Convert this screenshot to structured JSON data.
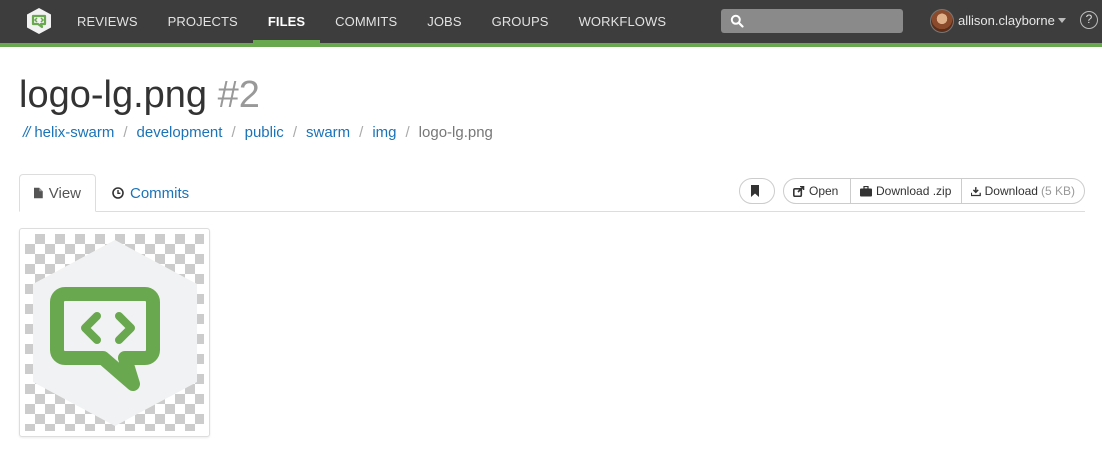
{
  "nav": {
    "items": [
      {
        "label": "REVIEWS",
        "active": false
      },
      {
        "label": "PROJECTS",
        "active": false
      },
      {
        "label": "FILES",
        "active": true
      },
      {
        "label": "COMMITS",
        "active": false
      },
      {
        "label": "JOBS",
        "active": false
      },
      {
        "label": "GROUPS",
        "active": false
      },
      {
        "label": "WORKFLOWS",
        "active": false
      }
    ],
    "search_placeholder": "",
    "user_name": "allison.clayborne",
    "help_label": "?",
    "accent_color": "#6aa84f"
  },
  "page": {
    "title": "logo-lg.png",
    "revision": "#2"
  },
  "breadcrumb": {
    "root": "//",
    "items": [
      "helix-swarm",
      "development",
      "public",
      "swarm",
      "img"
    ],
    "current": "logo-lg.png",
    "separator": "/"
  },
  "tabs": {
    "view": "View",
    "commits": "Commits"
  },
  "actions": {
    "open": "Open",
    "download_zip": "Download .zip",
    "download": "Download",
    "download_size": "(5 KB)"
  },
  "preview": {
    "alt": "logo-lg.png preview",
    "logo_color": "#6aa84f"
  }
}
